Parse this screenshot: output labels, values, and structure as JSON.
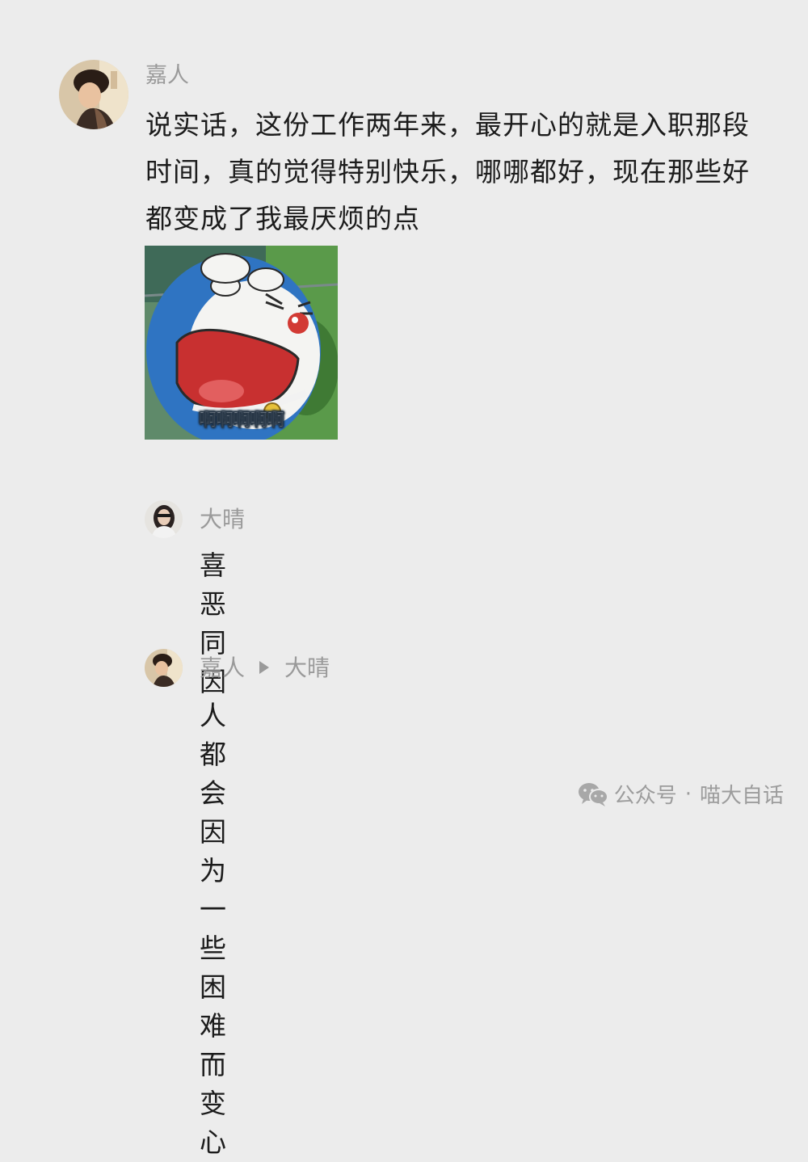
{
  "comments": [
    {
      "author": "嘉人",
      "text": "说实话，这份工作两年来，最开心的就是入职那段时间，真的觉得特别快乐，哪哪都好，现在那些好都变成了我最厌烦的点",
      "sticker": {
        "icon": "doraemon-screaming-sticker",
        "caption": "啊啊啊啊啊"
      }
    }
  ],
  "replies": [
    {
      "author": "大晴",
      "text": "喜恶同因"
    },
    {
      "author": "嘉人",
      "reply_to": "大晴",
      "text": "人都会因为一些困难而变心"
    }
  ],
  "watermark": {
    "icon": "wechat-icon",
    "label": "公众号",
    "separator": "·",
    "account": "喵大自话"
  },
  "colors": {
    "background": "#ececec",
    "username": "#9a9a9a",
    "text": "#1c1c1c",
    "watermark": "#9c9c9c"
  }
}
